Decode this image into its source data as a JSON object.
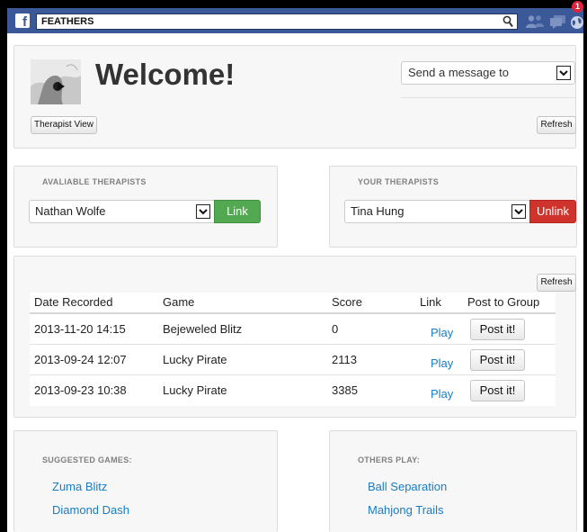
{
  "topbar": {
    "app_name": "FEATHERS",
    "notification_count": "1"
  },
  "welcome": {
    "title": "Welcome!",
    "send_message_placeholder": "Send a message to",
    "therapist_view_label": "Therapist View",
    "refresh_label": "Refresh"
  },
  "available_therapists": {
    "title": "AVALIABLE THERAPISTS",
    "selected": "Nathan Wolfe",
    "link_label": "Link"
  },
  "your_therapists": {
    "title": "YOUR THERAPISTS",
    "selected": "Tina Hung",
    "unlink_label": "Unlink"
  },
  "scores": {
    "refresh_label": "Refresh",
    "headers": {
      "date": "Date Recorded",
      "game": "Game",
      "score": "Score",
      "link": "Link",
      "post": "Post to Group"
    },
    "rows": [
      {
        "date": "2013-11-20 14:15",
        "game": "Bejeweled Blitz",
        "score": "0",
        "link": "Play",
        "post": "Post it!"
      },
      {
        "date": "2013-09-24 12:07",
        "game": "Lucky Pirate",
        "score": "2113",
        "link": "Play",
        "post": "Post it!"
      },
      {
        "date": "2013-09-23 10:38",
        "game": "Lucky Pirate",
        "score": "3385",
        "link": "Play",
        "post": "Post it!"
      }
    ]
  },
  "suggested": {
    "title": "SUGGESTED GAMES:",
    "games": [
      "Zuma Blitz",
      "Diamond Dash"
    ]
  },
  "others": {
    "title": "OTHERS PLAY:",
    "games": [
      "Ball Separation",
      "Mahjong Trails"
    ]
  },
  "colors": {
    "facebook_blue": "#3b5998",
    "link_green": "#52a952",
    "unlink_red": "#d0332b",
    "link_text_blue": "#1a7cc4"
  },
  "icons": [
    "facebook-logo-icon",
    "search-icon",
    "friends-icon",
    "messages-icon",
    "globe-icon",
    "chevron-down-icon"
  ]
}
